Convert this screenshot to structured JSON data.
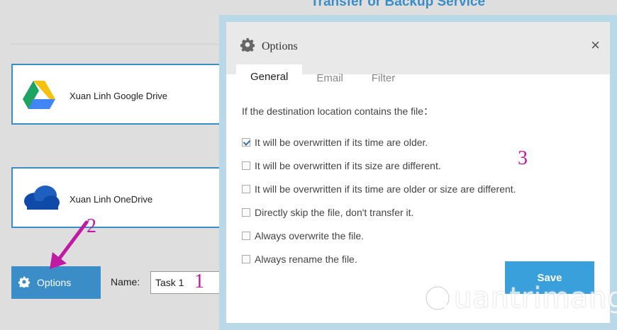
{
  "background": {
    "title": "Transfer or Backup Service",
    "clouds": [
      {
        "label": "Xuan Linh Google Drive",
        "icon": "google-drive-icon"
      },
      {
        "label": "Xuan Linh OneDrive",
        "icon": "onedrive-icon"
      }
    ],
    "options_button": {
      "label": "Options",
      "icon": "gear-icon"
    },
    "name_label": "Name:",
    "name_value": "Task 1"
  },
  "annotations": {
    "step1": "1",
    "step2": "2",
    "step3": "3"
  },
  "modal": {
    "title": "Options",
    "close_glyph": "×",
    "tabs": [
      {
        "label": "General",
        "active": true
      },
      {
        "label": "Email",
        "active": false
      },
      {
        "label": "Filter",
        "active": false
      }
    ],
    "intro": "If the destination location contains the file：",
    "options": [
      {
        "label": "It will be overwritten if its time are older.",
        "checked": true
      },
      {
        "label": "It will be overwritten if its size are different.",
        "checked": false
      },
      {
        "label": "It will be overwritten if its time are older or size are different.",
        "checked": false
      },
      {
        "label": "Directly skip the file, don't transfer it.",
        "checked": false
      },
      {
        "label": "Always overwrite the file.",
        "checked": false
      },
      {
        "label": "Always rename the file.",
        "checked": false
      }
    ],
    "save_label": "Save"
  },
  "watermark": "uantrimang",
  "colors": {
    "accent": "#3a8dc7",
    "save": "#3aa0dc",
    "annotation": "#c01aa3",
    "modal_frame": "#b9d9e9"
  }
}
